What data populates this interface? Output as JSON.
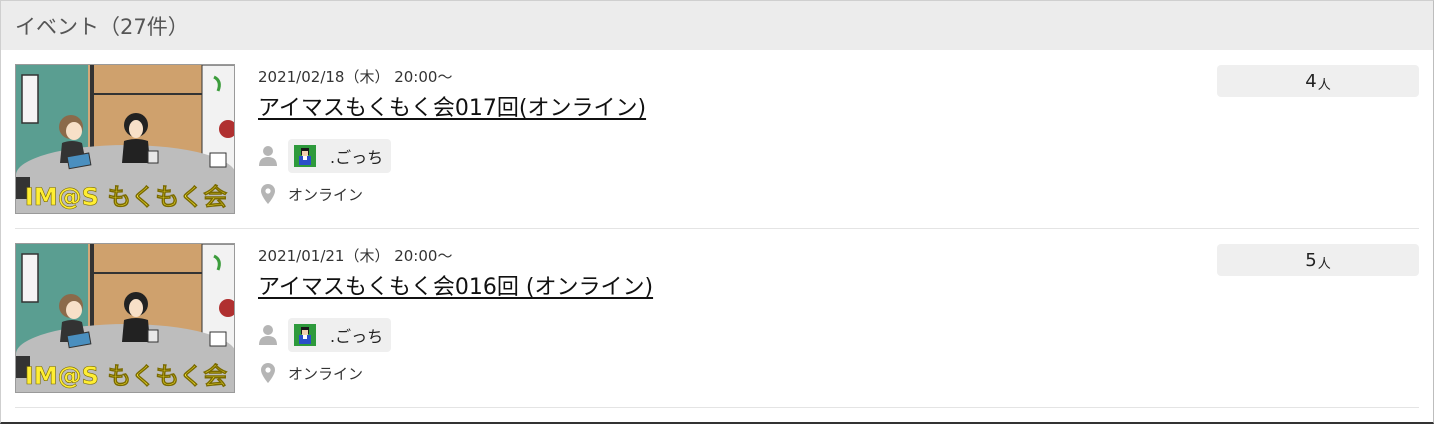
{
  "header": {
    "title": "イベント（27件）"
  },
  "events": [
    {
      "date": "2021/02/18（木） 20:00〜",
      "title": "アイマスもくもく会017回(オンライン)",
      "organizer": ".ごっち",
      "place": "オンライン",
      "count": "4",
      "count_unit": "人",
      "thumbnail_text": "IM@S もくもく会"
    },
    {
      "date": "2021/01/21（木） 20:00〜",
      "title": "アイマスもくもく会016回 (オンライン)",
      "organizer": ".ごっち",
      "place": "オンライン",
      "count": "5",
      "count_unit": "人",
      "thumbnail_text": "IM@S もくもく会"
    }
  ],
  "icons": {
    "organizer": "person-icon",
    "place": "map-pin-icon"
  },
  "colors": {
    "header_bg": "#ececec",
    "chip_bg": "#efefef",
    "icon_gray": "#b5b5b5"
  }
}
